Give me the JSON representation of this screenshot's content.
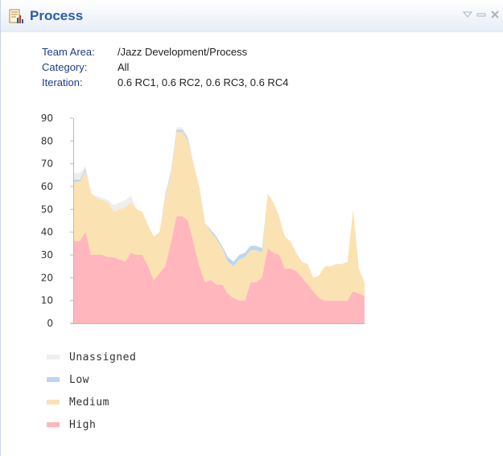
{
  "widget": {
    "title": "Process",
    "icon": "report-chart-icon",
    "controls": [
      "dropdown-arrow-icon",
      "minimize-icon",
      "close-icon"
    ]
  },
  "meta": {
    "team_area_label": "Team Area:",
    "team_area_value": "/Jazz Development/Process",
    "category_label": "Category:",
    "category_value": "All",
    "iteration_label": "Iteration:",
    "iteration_value": "0.6 RC1, 0.6 RC2, 0.6 RC3, 0.6 RC4"
  },
  "chart_data": {
    "type": "area",
    "stacked": true,
    "ylim": [
      0,
      90
    ],
    "yticks": [
      0,
      10,
      20,
      30,
      40,
      50,
      60,
      70,
      80,
      90
    ],
    "grid": false,
    "legend_position": "bottom-left",
    "series": [
      {
        "name": "High",
        "color": "#ffb7bd",
        "values": [
          36,
          36,
          40,
          30,
          30,
          30,
          29,
          29,
          28,
          27,
          31,
          30,
          30,
          25,
          19,
          22,
          25,
          35,
          47,
          47,
          45,
          35,
          25,
          18,
          19,
          17,
          17,
          13,
          11,
          10,
          10,
          18,
          18,
          20,
          33,
          31,
          30,
          24,
          24,
          23,
          20,
          17,
          14,
          11,
          10,
          10,
          10,
          10,
          10,
          14,
          13,
          12
        ]
      },
      {
        "name": "Medium",
        "color": "#fbe2b2",
        "values": [
          26,
          26,
          27,
          27,
          25,
          24,
          24,
          20,
          22,
          24,
          22,
          20,
          19,
          18,
          19,
          18,
          30,
          30,
          37,
          37,
          35,
          35,
          35,
          26,
          21,
          20,
          16,
          14,
          14,
          18,
          19,
          14,
          14,
          11,
          24,
          22,
          17,
          14,
          12,
          8,
          7,
          9,
          6,
          10,
          15,
          15,
          16,
          16,
          17,
          36,
          11,
          6
        ]
      },
      {
        "name": "Low",
        "color": "#bed5f0",
        "values": [
          1,
          1,
          1,
          0,
          0,
          0,
          0,
          0,
          0,
          0,
          0,
          0,
          0,
          0,
          0,
          0,
          1,
          1,
          1,
          1,
          1,
          0,
          0,
          0,
          1,
          1,
          1,
          2,
          2,
          2,
          2,
          2,
          2,
          2,
          0,
          0,
          0,
          0,
          0,
          0,
          0,
          0,
          0,
          0,
          0,
          0,
          0,
          0,
          0,
          0,
          0,
          0
        ]
      },
      {
        "name": "Unassigned",
        "color": "#eeeeee",
        "values": [
          3,
          3,
          1,
          0,
          1,
          1,
          1,
          3,
          3,
          3,
          3,
          0,
          0,
          0,
          0,
          0,
          1,
          1,
          1,
          1,
          1,
          0,
          0,
          0,
          0,
          0,
          0,
          0,
          0,
          0,
          0,
          0,
          0,
          0,
          0,
          0,
          0,
          0,
          0,
          0,
          0,
          0,
          0,
          0,
          0,
          0,
          0,
          0,
          0,
          0,
          0,
          0
        ]
      }
    ]
  },
  "legend": [
    {
      "label": "Unassigned",
      "color": "#eeeeee"
    },
    {
      "label": "Low",
      "color": "#bed5f0"
    },
    {
      "label": "Medium",
      "color": "#fbe2b2"
    },
    {
      "label": "High",
      "color": "#ffb7bd"
    }
  ]
}
